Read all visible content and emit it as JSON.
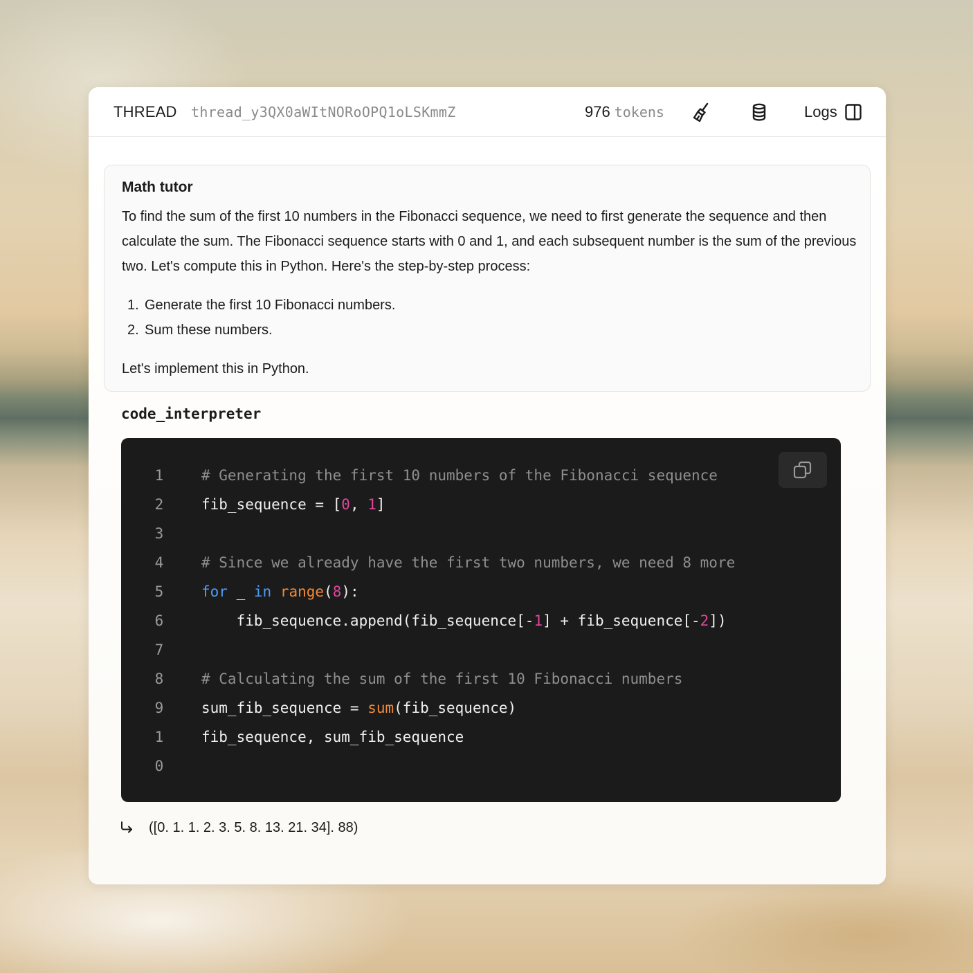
{
  "header": {
    "thread_label": "THREAD",
    "thread_id": "thread_y3QX0aWItNORoOPQ1oLSKmmZ",
    "token_count": "976",
    "token_unit": "tokens",
    "logs_label": "Logs"
  },
  "message": {
    "role": "Math tutor",
    "paragraph": "To find the sum of the first 10 numbers in the Fibonacci sequence, we need to first generate the sequence and then calculate the sum. The Fibonacci sequence starts with 0 and 1, and each subsequent number is the sum of the previous two. Let's compute this in Python. Here's the step-by-step process:",
    "steps": [
      {
        "num": "1.",
        "text": "Generate the first 10 Fibonacci numbers."
      },
      {
        "num": "2.",
        "text": "Sum these numbers."
      }
    ],
    "footer": "Let's implement this in Python."
  },
  "tool": {
    "name": "code_interpreter",
    "line_numbers": [
      "1",
      "2",
      "3",
      "4",
      "5",
      "6",
      "7",
      "8",
      "9",
      "1",
      "0"
    ],
    "code": [
      [
        {
          "t": "# Generating the first 10 numbers of the Fibonacci sequence",
          "k": "com"
        }
      ],
      [
        {
          "t": "fib_sequence = [",
          "k": "plain"
        },
        {
          "t": "0",
          "k": "num"
        },
        {
          "t": ", ",
          "k": "plain"
        },
        {
          "t": "1",
          "k": "num"
        },
        {
          "t": "]",
          "k": "plain"
        }
      ],
      [],
      [
        {
          "t": "# Since we already have the first two numbers, we need 8 more",
          "k": "com"
        }
      ],
      [
        {
          "t": "for",
          "k": "kw"
        },
        {
          "t": " _ ",
          "k": "plain"
        },
        {
          "t": "in",
          "k": "kw"
        },
        {
          "t": " ",
          "k": "plain"
        },
        {
          "t": "range",
          "k": "bi"
        },
        {
          "t": "(",
          "k": "plain"
        },
        {
          "t": "8",
          "k": "num"
        },
        {
          "t": "):",
          "k": "plain"
        }
      ],
      [
        {
          "t": "    fib_sequence.append(fib_sequence[-",
          "k": "plain"
        },
        {
          "t": "1",
          "k": "num"
        },
        {
          "t": "] + fib_sequence[-",
          "k": "plain"
        },
        {
          "t": "2",
          "k": "num"
        },
        {
          "t": "])",
          "k": "plain"
        }
      ],
      [],
      [
        {
          "t": "# Calculating the sum of the first 10 Fibonacci numbers",
          "k": "com"
        }
      ],
      [
        {
          "t": "sum_fib_sequence = ",
          "k": "plain"
        },
        {
          "t": "sum",
          "k": "bi"
        },
        {
          "t": "(fib_sequence)",
          "k": "plain"
        }
      ],
      [
        {
          "t": "fib_sequence, sum_fib_sequence",
          "k": "plain"
        }
      ],
      []
    ],
    "output": "([0. 1. 1. 2. 3. 5. 8. 13. 21. 34]. 88)"
  },
  "icons": {
    "clear": "broom-icon",
    "storage": "database-icon",
    "logs": "sidebar-panel-icon",
    "copy": "copy-icon",
    "output": "return-arrow-icon"
  },
  "colors": {
    "code_bg": "#1b1b1b",
    "comment": "#8f8f8f",
    "keyword": "#4e9cf5",
    "builtin": "#f08a3c",
    "number": "#e0459b"
  }
}
